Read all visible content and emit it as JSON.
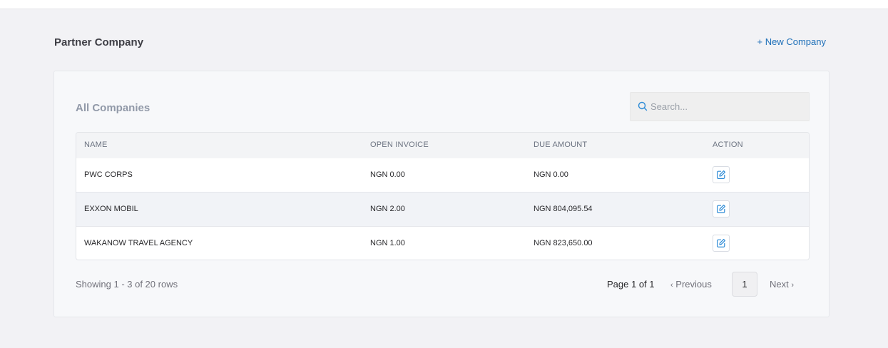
{
  "header": {
    "title": "Partner Company",
    "new_company_label": "+ New Company"
  },
  "card": {
    "title": "All Companies",
    "search_placeholder": "Search..."
  },
  "table": {
    "columns": [
      "NAME",
      "OPEN INVOICE",
      "DUE AMOUNT",
      "ACTION"
    ],
    "rows": [
      {
        "name": "PWC CORPS",
        "open_invoice": "NGN 0.00",
        "due_amount": "NGN 0.00"
      },
      {
        "name": "EXXON MOBIL",
        "open_invoice": "NGN 2.00",
        "due_amount": "NGN 804,095.54"
      },
      {
        "name": "WAKANOW TRAVEL AGENCY",
        "open_invoice": "NGN 1.00",
        "due_amount": "NGN 823,650.00"
      }
    ]
  },
  "footer": {
    "showing": "Showing 1 - 3 of 20 rows",
    "page_label": "Page 1 of 1",
    "previous": "Previous",
    "current_page": "1",
    "next": "Next",
    "prev_chevron": "‹",
    "next_chevron": "›"
  },
  "icons": {
    "search": "search-icon",
    "edit": "edit-icon"
  },
  "colors": {
    "accent": "#1d6fb8",
    "icon_blue": "#2b8ad6"
  }
}
